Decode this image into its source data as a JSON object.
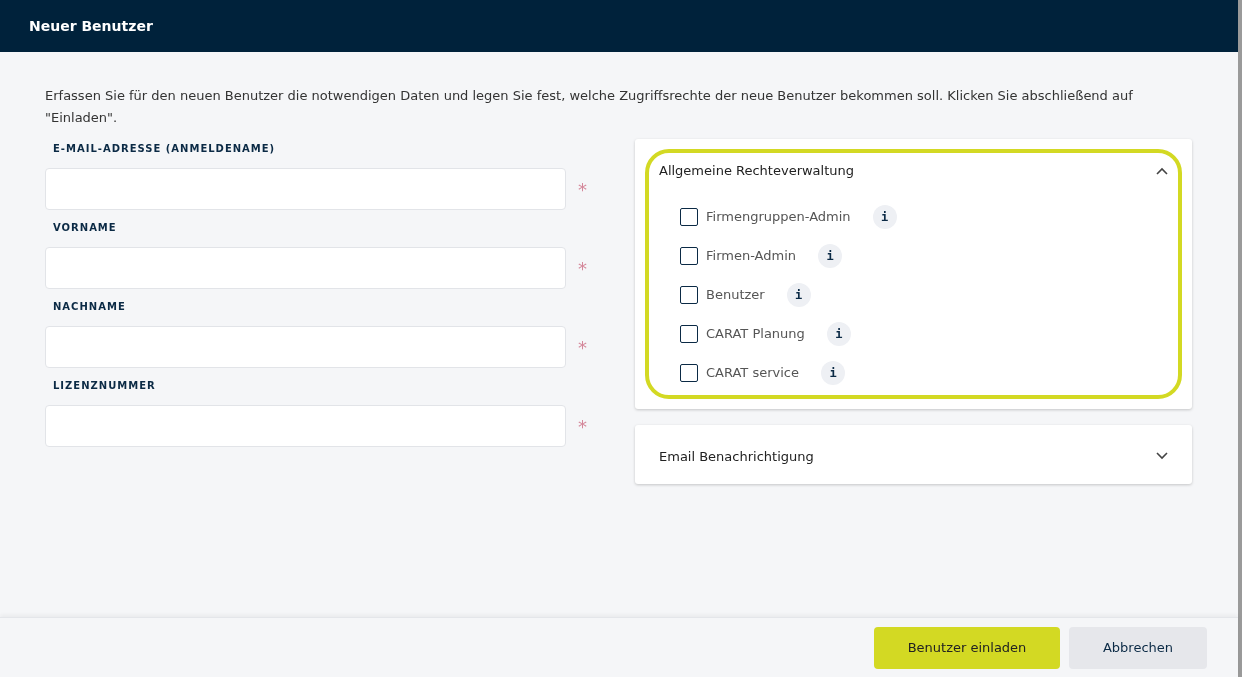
{
  "window": {
    "title": "Neuer Benutzer"
  },
  "intro": "Erfassen Sie für den neuen Benutzer die notwendigen Daten und legen Sie fest, welche Zugriffsrechte der neue Benutzer bekommen soll. Klicken Sie abschließend auf \"Einladen\".",
  "fields": [
    {
      "label": "E-MAIL-ADRESSE (ANMELDENAME)",
      "required_mark": "*"
    },
    {
      "label": "VORNAME",
      "required_mark": "*"
    },
    {
      "label": "NACHNAME",
      "required_mark": "*"
    },
    {
      "label": "LIZENZNUMMER",
      "required_mark": "*"
    }
  ],
  "sections": [
    {
      "title": "Allgemeine Rechteverwaltung",
      "expanded": true,
      "highlighted": true,
      "items": [
        {
          "label": "Firmengruppen-Admin",
          "checked": false,
          "info": "i"
        },
        {
          "label": "Firmen-Admin",
          "checked": false,
          "info": "i"
        },
        {
          "label": "Benutzer",
          "checked": false,
          "info": "i"
        },
        {
          "label": "CARAT Planung",
          "checked": false,
          "info": "i"
        },
        {
          "label": "CARAT service",
          "checked": false,
          "info": "i"
        }
      ]
    },
    {
      "title": "Email Benachrichtigung",
      "expanded": false,
      "highlighted": false
    }
  ],
  "buttons": [
    {
      "label": "Benutzer einladen",
      "kind": "primary"
    },
    {
      "label": "Abbrechen",
      "kind": "secondary"
    }
  ]
}
